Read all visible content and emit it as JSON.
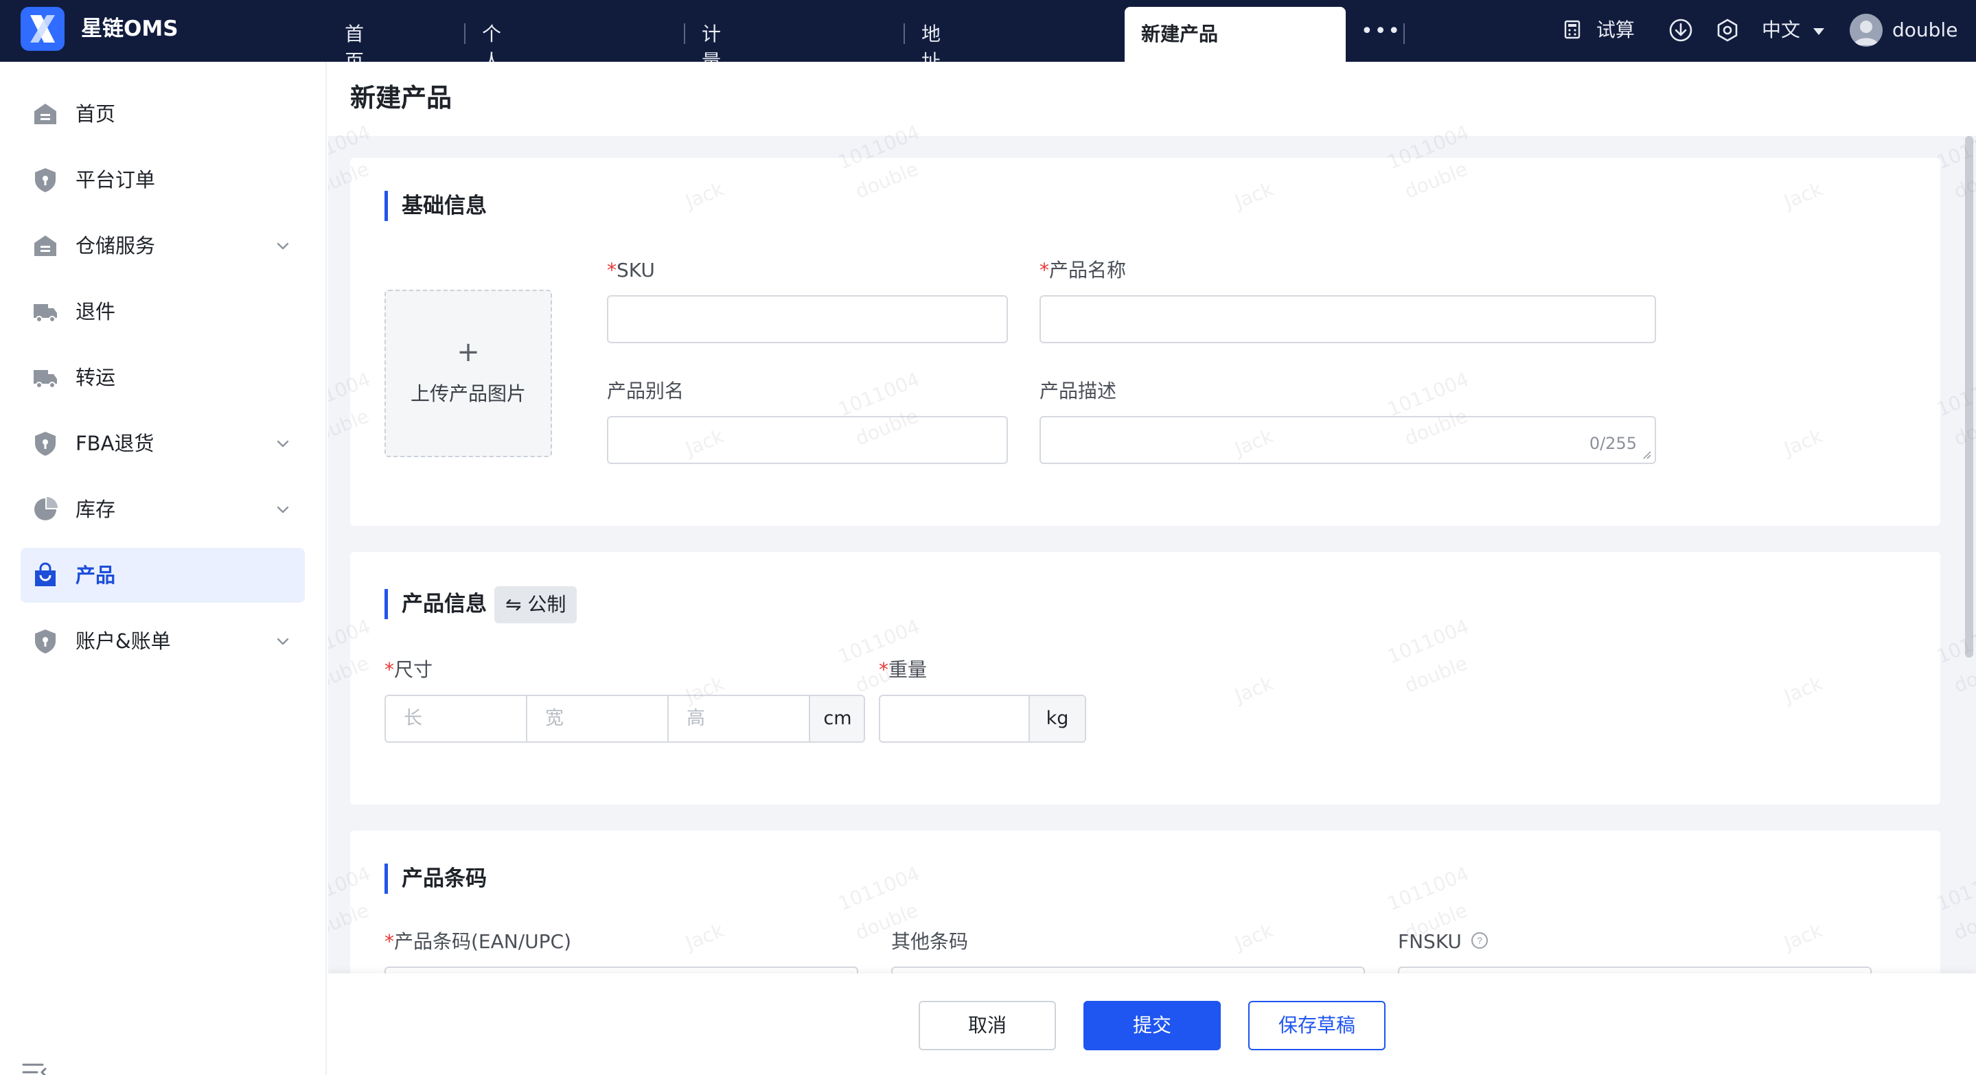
{
  "app": {
    "name": "星链OMS"
  },
  "tabs": [
    {
      "label": "首页"
    },
    {
      "label": "个人中心"
    },
    {
      "label": "计量单位"
    },
    {
      "label": "地址簿"
    },
    {
      "label": "新建产品",
      "active": true
    }
  ],
  "tabs_more": "•••",
  "header_right": {
    "calculator_label": "试算",
    "language": "中文",
    "username": "double"
  },
  "sidebar": {
    "items": [
      {
        "label": "首页",
        "icon": "home-icon",
        "expandable": false
      },
      {
        "label": "平台订单",
        "icon": "shield-icon",
        "expandable": false
      },
      {
        "label": "仓储服务",
        "icon": "warehouse-icon",
        "expandable": true
      },
      {
        "label": "退件",
        "icon": "truck-icon",
        "expandable": false
      },
      {
        "label": "转运",
        "icon": "truck-icon",
        "expandable": false
      },
      {
        "label": "FBA退货",
        "icon": "shield-icon",
        "expandable": true
      },
      {
        "label": "库存",
        "icon": "pie-chart-icon",
        "expandable": true
      },
      {
        "label": "产品",
        "icon": "shopping-bag-icon",
        "expandable": false,
        "active": true
      },
      {
        "label": "账户&账单",
        "icon": "shield-icon",
        "expandable": true
      }
    ]
  },
  "page": {
    "title": "新建产品"
  },
  "basic_info": {
    "title": "基础信息",
    "upload_plus": "+",
    "upload_label": "上传产品图片",
    "sku_label": "SKU",
    "name_label": "产品名称",
    "alias_label": "产品别名",
    "desc_label": "产品描述",
    "desc_counter": "0/255",
    "required_mark": "*"
  },
  "product_info": {
    "title": "产品信息",
    "unit_toggle": "公制",
    "size_label": "尺寸",
    "length_placeholder": "长",
    "width_placeholder": "宽",
    "height_placeholder": "高",
    "size_unit": "cm",
    "weight_label": "重量",
    "weight_unit": "kg"
  },
  "barcode": {
    "title": "产品条码",
    "ean_label": "产品条码(EAN/UPC)",
    "other_label": "其他条码",
    "fnsku_label": "FNSKU"
  },
  "footer": {
    "cancel": "取消",
    "submit": "提交",
    "save_draft": "保存草稿"
  },
  "watermark": [
    "1011004",
    "double",
    "Jack"
  ],
  "colors": {
    "topbar": "#111c3d",
    "primary": "#1f55f0",
    "active_nav_bg": "#eaf0ff",
    "required": "#e53935"
  }
}
